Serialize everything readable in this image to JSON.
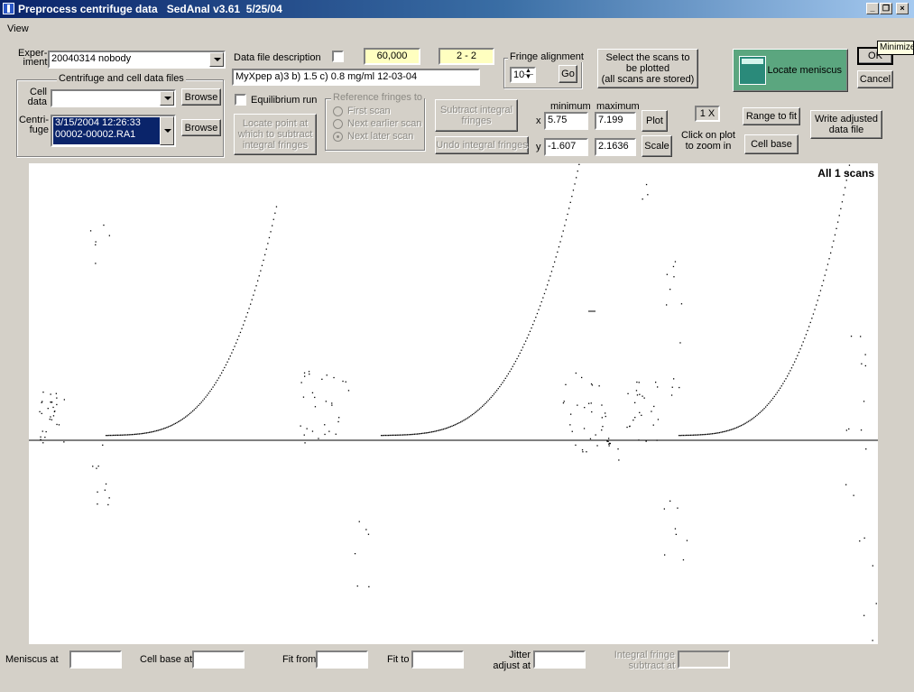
{
  "window": {
    "title": "Preprocess centrifuge data   SedAnal v3.61  5/25/04",
    "buttons": {
      "minimize": "_",
      "restore": "❐",
      "close": "×"
    }
  },
  "menu": {
    "items": [
      "View"
    ]
  },
  "tooltip": "Minimize",
  "experiment": {
    "label_line1": "Exper-",
    "label_line2": "iment",
    "value": "20040314 nobody"
  },
  "files_group": {
    "title": "Centrifuge and cell data files",
    "cell_label_line1": "Cell",
    "cell_label_line2": "data",
    "cell_value": "",
    "browse1": "Browse",
    "centrifuge_label_line1": "Centri-",
    "centrifuge_label_line2": "fuge",
    "centrifuge_value_line1": "3/15/2004  12:26:33",
    "centrifuge_value_line2": "00002-00002.RA1",
    "browse2": "Browse"
  },
  "description": {
    "label": "Data file description",
    "value": "MyXpep   a)3  b) 1.5 c) 0.8 mg/ml   12-03-04"
  },
  "rpm_value": "60,000",
  "cell_channel": "2 - 2",
  "fringe_alignment": {
    "title": "Fringe alignment",
    "value": "10",
    "go": "Go"
  },
  "select_scans": {
    "line1": "Select the scans to",
    "line2": "be plotted",
    "line3": "(all scans are stored)"
  },
  "locate_meniscus": "Locate meniscus",
  "ok": "OK",
  "cancel": "Cancel",
  "equilibrium_label": "Equilibrium run",
  "locate_point": {
    "line1": "Locate point at",
    "line2": "which to subtract",
    "line3": "integral fringes"
  },
  "reference_group": {
    "title": "Reference fringes to",
    "options": [
      "First scan",
      "Next earlier scan",
      "Next later scan"
    ],
    "selected": 2
  },
  "subtract_integral": {
    "line1": "Subtract integral",
    "line2": "fringes"
  },
  "undo_integral": "Undo integral fringes",
  "range": {
    "min_header": "minimum",
    "max_header": "maximum",
    "x_label": "x",
    "x_min": "5.75",
    "x_max": "7.199",
    "y_label": "y",
    "y_min": "-1.607",
    "y_max": "2.1636"
  },
  "plot_button": "Plot",
  "scale_button": "Scale",
  "zoom": {
    "value": "1 X",
    "hint_line1": "Click on plot",
    "hint_line2": "to zoom in"
  },
  "range_to_fit": "Range to fit",
  "cell_base": "Cell base",
  "write_adjusted": {
    "line1": "Write adjusted",
    "line2": "data file"
  },
  "plot": {
    "caption": "All 1 scans"
  },
  "bottom": {
    "meniscus_label": "Meniscus at",
    "meniscus_value": "",
    "cellbase_label": "Cell base at",
    "cellbase_value": "",
    "fitfrom_label": "Fit from",
    "fitfrom_value": "",
    "fitto_label": "Fit to",
    "fitto_value": "",
    "jitter_line1": "Jitter",
    "jitter_line2": "adjust at",
    "jitter_value": "",
    "integral_line1": "Integral fringe",
    "integral_line2": "subtract at",
    "integral_value": ""
  },
  "colors": {
    "titlebar": "#0a246a",
    "selection": "#0a246a",
    "meniscus_button": "#5ba67f",
    "highlight_field": "#ffffc0"
  }
}
